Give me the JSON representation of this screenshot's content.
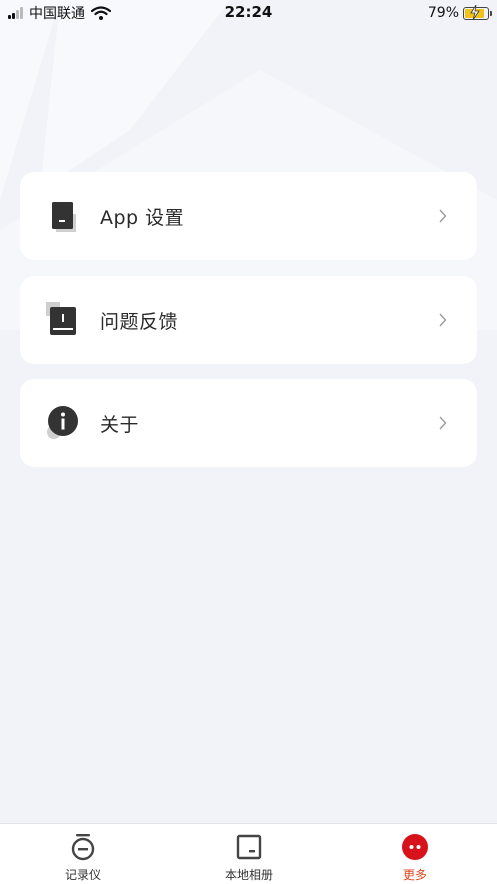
{
  "status_bar": {
    "carrier": "中国联通",
    "time": "22:24",
    "battery": "79%",
    "battery_level": 0.79
  },
  "menu": [
    {
      "label": "App 设置",
      "icon": "app-settings-icon"
    },
    {
      "label": "问题反馈",
      "icon": "feedback-icon"
    },
    {
      "label": "关于",
      "icon": "info-icon"
    }
  ],
  "tabs": [
    {
      "label": "记录仪",
      "icon": "recorder-icon",
      "active": false
    },
    {
      "label": "本地相册",
      "icon": "album-icon",
      "active": false
    },
    {
      "label": "更多",
      "icon": "more-icon",
      "active": true
    }
  ],
  "colors": {
    "background": "#f1f3f8",
    "card": "#ffffff",
    "accent_text": "#e0451d",
    "accent_badge": "#d8121b",
    "icon_dark": "#333333"
  }
}
